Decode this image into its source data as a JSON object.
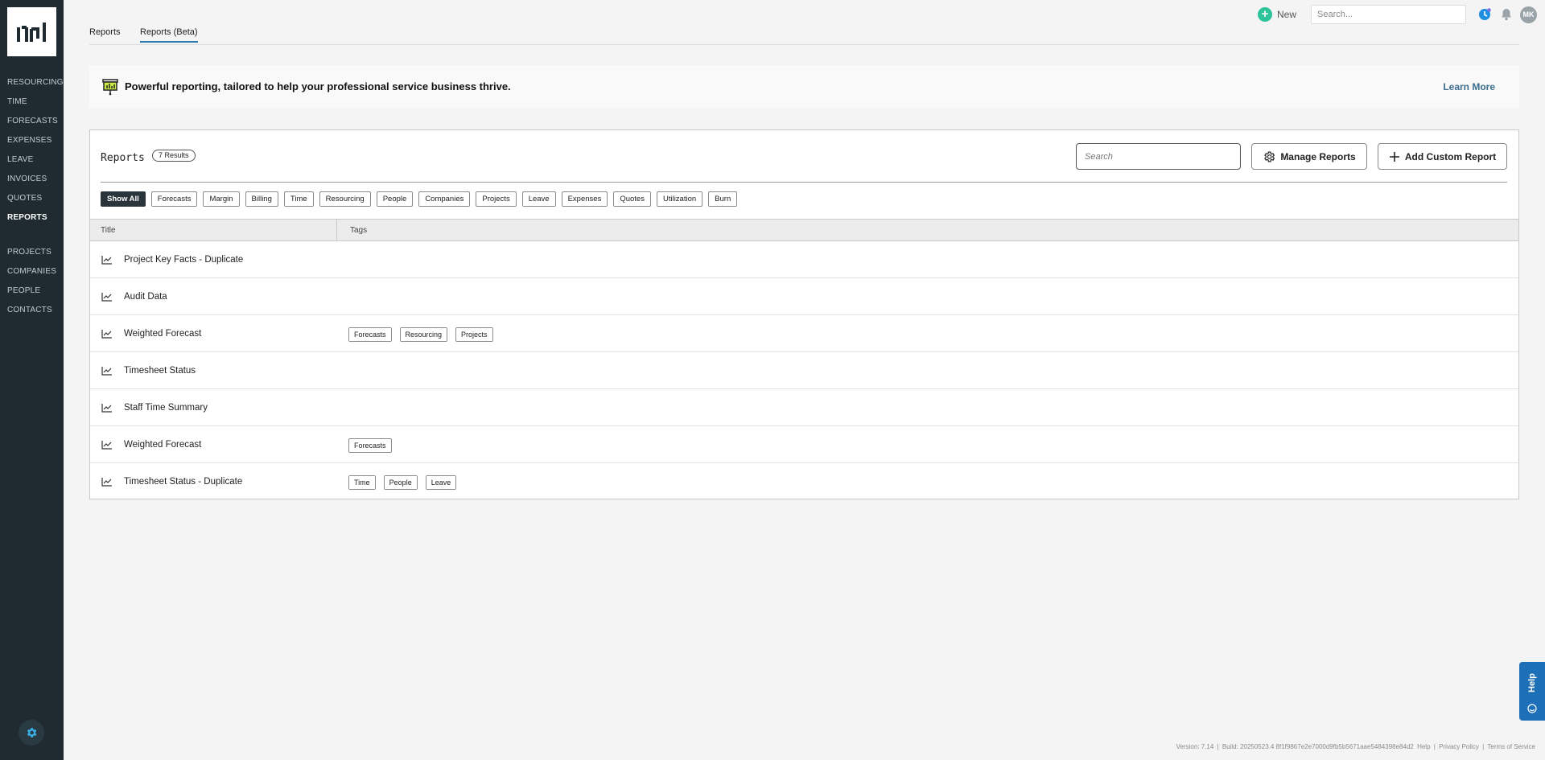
{
  "nav": {
    "top_items": [
      {
        "label": "RESOURCING"
      },
      {
        "label": "TIME"
      },
      {
        "label": "FORECASTS"
      },
      {
        "label": "EXPENSES"
      },
      {
        "label": "LEAVE"
      },
      {
        "label": "INVOICES"
      },
      {
        "label": "QUOTES"
      },
      {
        "label": "REPORTS",
        "active": true
      }
    ],
    "bottom_items": [
      {
        "label": "PROJECTS"
      },
      {
        "label": "COMPANIES"
      },
      {
        "label": "PEOPLE"
      },
      {
        "label": "CONTACTS"
      }
    ],
    "settings_icon": "gear-icon"
  },
  "topbar": {
    "new_label": "New",
    "search_placeholder": "Search...",
    "avatar_initials": "MK",
    "accent": "#2cc39a"
  },
  "tabs": [
    {
      "label": "Reports"
    },
    {
      "label": "Reports (Beta)",
      "active": true
    }
  ],
  "banner": {
    "text": "Powerful reporting, tailored to help your professional service business thrive.",
    "learn_more": "Learn More"
  },
  "reports": {
    "title": "Reports",
    "results_badge": "7 Results",
    "search_placeholder": "Search",
    "manage_label": "Manage Reports",
    "add_label": "Add Custom Report",
    "filters": [
      "Show All",
      "Forecasts",
      "Margin",
      "Billing",
      "Time",
      "Resourcing",
      "People",
      "Companies",
      "Projects",
      "Leave",
      "Expenses",
      "Quotes",
      "Utilization",
      "Burn"
    ],
    "active_filter": "Show All",
    "columns": {
      "title": "Title",
      "tags": "Tags"
    },
    "rows": [
      {
        "title": "Project Key Facts - Duplicate",
        "tags": []
      },
      {
        "title": "Audit Data",
        "tags": []
      },
      {
        "title": "Weighted Forecast",
        "tags": [
          "Forecasts",
          "Resourcing",
          "Projects"
        ]
      },
      {
        "title": "Timesheet Status",
        "tags": []
      },
      {
        "title": "Staff Time Summary",
        "tags": []
      },
      {
        "title": "Weighted Forecast",
        "tags": [
          "Forecasts"
        ]
      },
      {
        "title": "Timesheet Status - Duplicate",
        "tags": [
          "Time",
          "People",
          "Leave"
        ]
      }
    ]
  },
  "help": {
    "label": "Help"
  },
  "footer": {
    "version": "Version: 7.14",
    "build": "Build: 20250523.4 8f1f9867e2e7000d9fb5b5671aae5484398e84d2",
    "help": "Help",
    "privacy": "Privacy Policy",
    "terms": "Terms of Service"
  }
}
